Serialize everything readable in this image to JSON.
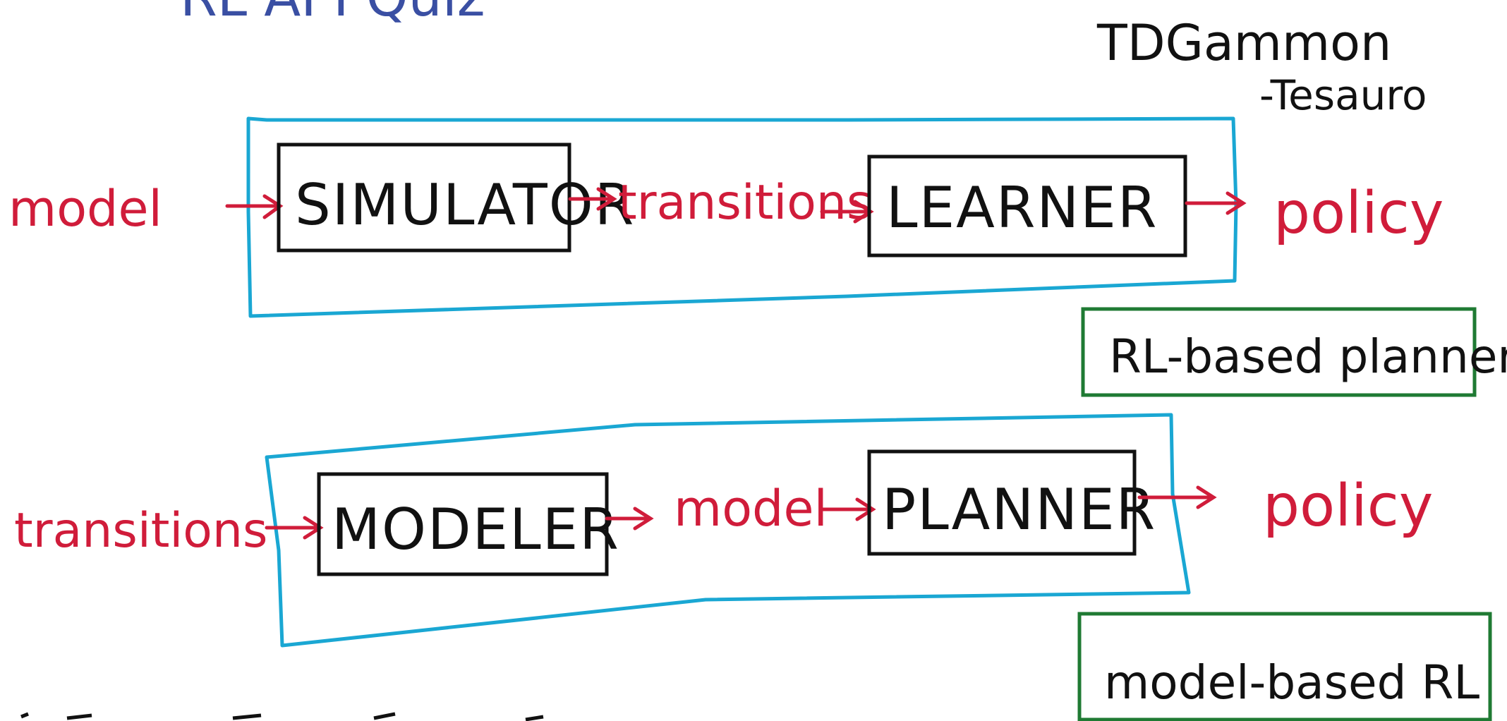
{
  "colors": {
    "red": "#d01c3a",
    "blue": "#1aa7d3",
    "green": "#1f7a33",
    "black": "#111111",
    "title_blue": "#3a4fa3"
  },
  "header": {
    "partial_title": "RL  API  Quiz"
  },
  "annotation": {
    "line1": "TDGammon",
    "line2": "-Tesauro"
  },
  "top_pipeline": {
    "input_label": "model",
    "box1_label": "SIMULATOR",
    "middle_label": "transitions",
    "box2_label": "LEARNER",
    "output_label": "policy",
    "category_label": "RL-based planner"
  },
  "bottom_pipeline": {
    "input_label": "transitions",
    "box1_label": "MODELER",
    "middle_label": "model",
    "box2_label": "PLANNER",
    "output_label": "policy",
    "category_label": "model-based RL"
  }
}
